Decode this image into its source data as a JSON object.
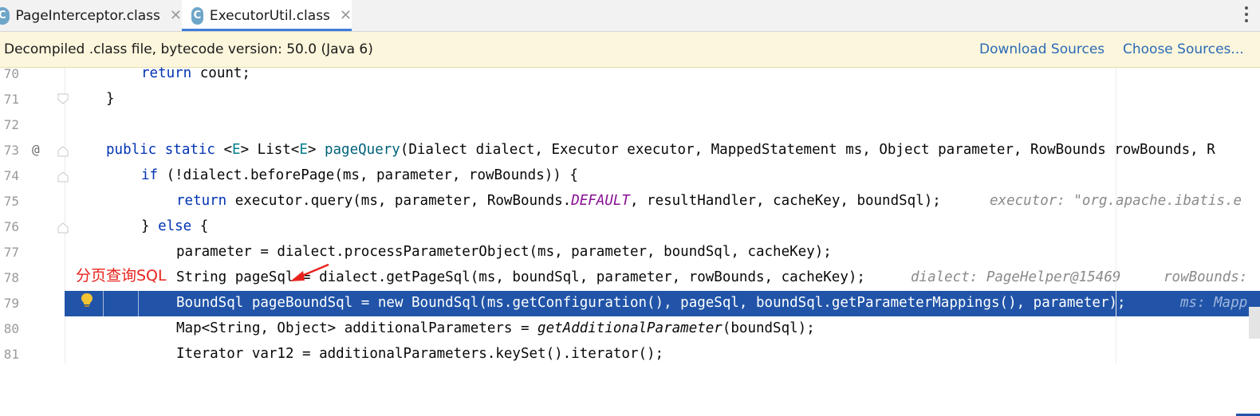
{
  "tabs": [
    {
      "icon": "class-icon",
      "icon_letter": "C",
      "label": "PageInterceptor.class",
      "active": false
    },
    {
      "icon": "class-icon",
      "icon_letter": "C",
      "label": "ExecutorUtil.class",
      "active": true
    }
  ],
  "notice": {
    "message": "Decompiled .class file, bytecode version: 50.0 (Java 6)",
    "download_sources": "Download Sources",
    "choose_sources": "Choose Sources..."
  },
  "gutter": {
    "line_numbers": [
      "70",
      "71",
      "72",
      "73",
      "74",
      "75",
      "76",
      "77",
      "78",
      "79",
      "80",
      "81"
    ],
    "override_marker": "@"
  },
  "code": {
    "l70": {
      "kw": "return",
      "rest": " count;"
    },
    "l71": {
      "text": "}"
    },
    "l73": {
      "kw1": "public static",
      "p1": " <",
      "e1": "E",
      "p2": "> List<",
      "e2": "E",
      "p3": "> ",
      "fn": "pageQuery",
      "rest": "(Dialect dialect, Executor executor, MappedStatement ms, Object parameter, RowBounds rowBounds, R"
    },
    "l74": {
      "kw": "if",
      "rest": " (!dialect.beforePage(ms, parameter, rowBounds)) {"
    },
    "l75": {
      "kw": "return",
      "p1": " executor.query(ms, parameter, RowBounds.",
      "it": "DEFAULT",
      "p2": ", resultHandler, cacheKey, boundSql);",
      "hint": "executor: \"org.apache.ibatis.e"
    },
    "l76": {
      "p1": "} ",
      "kw": "else",
      "p2": " {"
    },
    "l77": {
      "text": "parameter = dialect.processParameterObject(ms, parameter, boundSql, cacheKey);"
    },
    "l78": {
      "text": "String pageSql = dialect.getPageSql(ms, boundSql, parameter, rowBounds, cacheKey);",
      "hint1": "dialect: PageHelper@15469",
      "hint2": "rowBounds:"
    },
    "l79": {
      "p1": "BoundSql pageBoundSql = ",
      "kw": "new",
      "p2": " BoundSql(ms.getConfiguration(), pageSql, boundSql.getParameterMappings(), parameter);",
      "hint": "ms: Mapp"
    },
    "l80": {
      "p1": "Map<String, Object> additionalParameters = ",
      "mi": "getAdditionalParameter",
      "p2": "(boundSql);"
    },
    "l81": {
      "text": "Iterator var12 = additionalParameters.keySet().iterator();"
    }
  },
  "annotation": {
    "text": "分页查询SQL",
    "color": "#e8231d"
  },
  "colors": {
    "highlight": "#2154a8",
    "keyword": "#0033b3",
    "link": "#2b6ab7"
  }
}
